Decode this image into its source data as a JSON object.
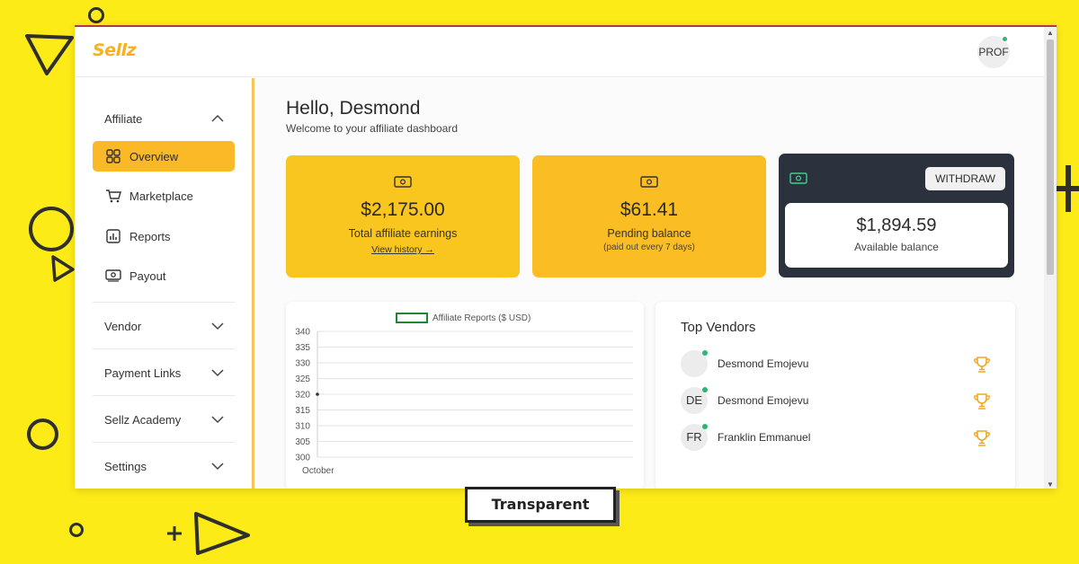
{
  "brand": {
    "logo": "Sellz",
    "accent": "#fbb928"
  },
  "topbar": {
    "profile_label": "PROF"
  },
  "sidebar": {
    "sections": [
      {
        "label": "Affiliate",
        "expanded": true
      },
      {
        "label": "Vendor",
        "expanded": false
      },
      {
        "label": "Payment Links",
        "expanded": false
      },
      {
        "label": "Sellz Academy",
        "expanded": false
      },
      {
        "label": "Settings",
        "expanded": false
      }
    ],
    "items": [
      {
        "label": "Overview",
        "icon": "grid-icon",
        "active": true
      },
      {
        "label": "Marketplace",
        "icon": "cart-icon",
        "active": false
      },
      {
        "label": "Reports",
        "icon": "bar-chart-icon",
        "active": false
      },
      {
        "label": "Payout",
        "icon": "money-icon",
        "active": false
      }
    ]
  },
  "main": {
    "greeting": "Hello, Desmond",
    "welcome": "Welcome to your affiliate dashboard",
    "cards": {
      "earnings": {
        "amount": "$2,175.00",
        "label": "Total affiliate earnings",
        "link": "View history"
      },
      "pending": {
        "amount": "$61.41",
        "label": "Pending balance",
        "note": "(paid out every 7 days)"
      },
      "available": {
        "amount": "$1,894.59",
        "label": "Available balance",
        "button": "WITHDRAW"
      }
    }
  },
  "chart_data": {
    "type": "line",
    "title": "",
    "series": [
      {
        "name": "Affiliate Reports ($ USD)",
        "color": "#1e8a2e",
        "values": [
          320
        ]
      }
    ],
    "categories": [
      "October"
    ],
    "ylim": [
      300,
      340
    ],
    "yticks": [
      300,
      305,
      310,
      315,
      320,
      325,
      330,
      335,
      340
    ],
    "grid": true,
    "legend": "top"
  },
  "vendors": {
    "title": "Top Vendors",
    "list": [
      {
        "initials": "",
        "name": "Desmond Emojevu"
      },
      {
        "initials": "DE",
        "name": "Desmond Emojevu"
      },
      {
        "initials": "FR",
        "name": "Franklin Emmanuel"
      }
    ]
  },
  "overlay_tag": "Transparent"
}
